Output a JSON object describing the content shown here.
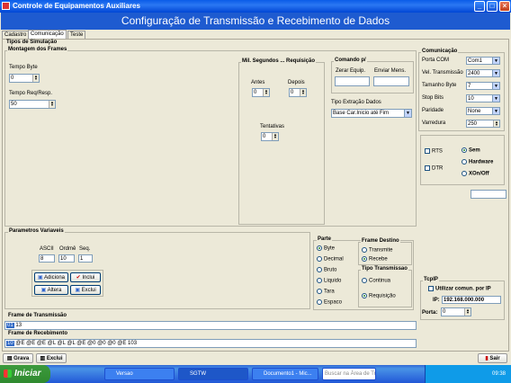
{
  "window": {
    "title": "Controle de Equipamentos Auxiliares"
  },
  "header": {
    "title": "Configuração de Transmissão e Recebimento de Dados"
  },
  "tabs": [
    {
      "label": "Cadastro"
    },
    {
      "label": "Comunicação"
    },
    {
      "label": "Teste"
    }
  ],
  "simulacao": {
    "title": "Tipos de Simulação",
    "montagem": {
      "title": "Montagem dos Frames",
      "tempo_byte_label": "Tempo Byte",
      "tempo_byte_value": "0",
      "tempo_req_label": "Tempo Req/Resp.",
      "tempo_req_value": "50"
    },
    "mil": {
      "title": "Mil. Segundos ... Requisição",
      "antes_label": "Antes",
      "antes_value": "0",
      "depois_label": "Depois",
      "depois_value": "0",
      "tentativas_label": "Tentativas",
      "tentativas_value": "0"
    },
    "comando": {
      "title": "Comando p/",
      "zerar_label": "Zerar Equip.",
      "enviar_label": "Enviar Mens.",
      "extracao_label": "Tipo Extração Dados",
      "extracao_value": "Base Car.Inicio até Fim"
    }
  },
  "parametros": {
    "title": "Parametros Variaveis",
    "ascii_label": "ASCII",
    "ascii_value": "8",
    "ordem_label": "Ordmê",
    "ordem_value": "10",
    "seq_label": "Seq.",
    "seq_value": "1",
    "adiciona": "Adiciona",
    "inclui": "Inclui",
    "altera": "Altera",
    "exclui": "Exclui"
  },
  "parte": {
    "title": "Parte",
    "options": [
      "Byte",
      "Decimal",
      "Bruto",
      "Liquido",
      "Tara",
      "Espaco"
    ],
    "selected": "Byte"
  },
  "frame_destino": {
    "title": "Frame Destino",
    "options": [
      "Transmite",
      "Recebe"
    ],
    "selected": "Recebe"
  },
  "tipo_transmissao": {
    "title": "Tipo Transmissao",
    "options": [
      "Continua",
      "Requisição"
    ],
    "selected": "Requisição"
  },
  "frame_tx": {
    "title": "Frame de Transmissão",
    "index": "01",
    "value": "13"
  },
  "frame_rx": {
    "title": "Frame de Recebimento",
    "index": "10",
    "value": "@E @E @E @L @L @L @E @0 @0 @0 @E 103"
  },
  "comunicacao": {
    "title": "Comunicação",
    "porta_label": "Porta COM",
    "porta_value": "Com1",
    "vel_label": "Vel. Transmissão",
    "vel_value": "2400",
    "tam_label": "Tamanho Byte",
    "tam_value": "7",
    "stop_label": "Stop Bits",
    "stop_value": "10",
    "paridade_label": "Paridade",
    "paridade_value": "None",
    "varredura_label": "Varredura",
    "varredura_value": "250"
  },
  "flow": {
    "rts": "RTS",
    "dtr": "DTR",
    "sem": "Sem",
    "hardware": "Hardware",
    "xon": "XOn/Off",
    "selected": "Sem"
  },
  "tcpip": {
    "title": "TcpIP",
    "use_label": "Utilizar comun. por IP",
    "ip_label": "IP:",
    "ip_value": "192.168.000.000",
    "porta_label": "Porta:",
    "porta_value": "0"
  },
  "bottom": {
    "grava": "Grava",
    "exclui": "Exclui",
    "sair": "Sair"
  },
  "taskbar": {
    "start": "Iniciar",
    "tasks": [
      "Versao",
      "SGTW",
      "Documento1 - Mic...",
      "Buscar na Área de Tr..."
    ],
    "time": "09:38"
  }
}
